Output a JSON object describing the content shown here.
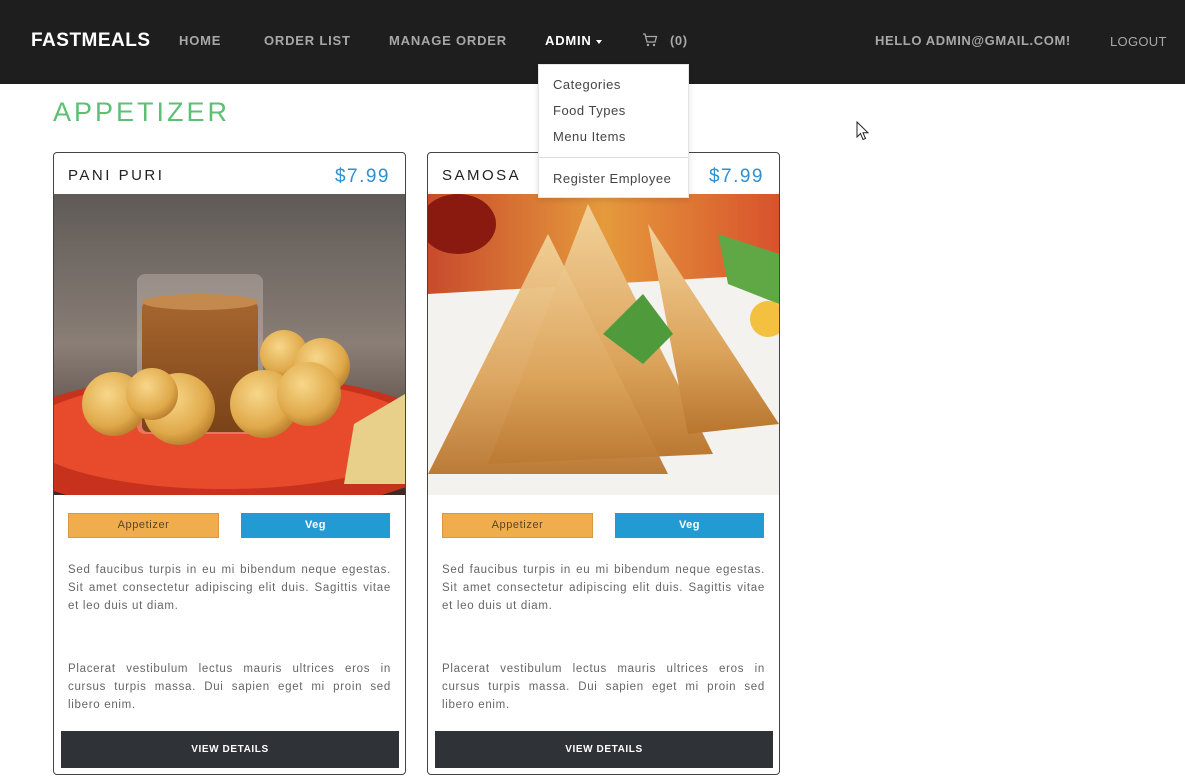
{
  "navbar": {
    "brand": "FASTMEALS",
    "links": {
      "home": "HOME",
      "order_list": "ORDER LIST",
      "manage_order": "MANAGE ORDER",
      "admin": "ADMIN"
    },
    "cart_count": "(0)",
    "greeting": "HELLO ADMIN@GMAIL.COM!",
    "logout": "LOGOUT"
  },
  "admin_menu": {
    "items": [
      "Categories",
      "Food Types",
      "Menu Items",
      "Register Employee"
    ]
  },
  "section": {
    "title": "APPETIZER"
  },
  "cards": [
    {
      "name": "PANI PURI",
      "price": "$7.99",
      "category": "Appetizer",
      "type": "Veg",
      "desc1": "Sed faucibus turpis in eu mi bibendum neque egestas. Sit amet consectetur adipiscing elit duis. Sagittis vitae et leo duis ut diam.",
      "desc2": "Placerat vestibulum lectus mauris ultrices eros in cursus turpis massa. Dui sapien eget mi proin sed libero enim.",
      "button": "VIEW DETAILS",
      "image_icon": "pani-puri-photo"
    },
    {
      "name": "SAMOSA",
      "price": "$7.99",
      "category": "Appetizer",
      "type": "Veg",
      "desc1": "Sed faucibus turpis in eu mi bibendum neque egestas. Sit amet consectetur adipiscing elit duis. Sagittis vitae et leo duis ut diam.",
      "desc2": "Placerat vestibulum lectus mauris ultrices eros in cursus turpis massa. Dui sapien eget mi proin sed libero enim.",
      "button": "VIEW DETAILS",
      "image_icon": "samosa-photo"
    }
  ],
  "colors": {
    "navbar_bg": "#1e1e1e",
    "section_title": "#5cbf74",
    "price": "#2f8fcf",
    "category_badge": "#f0ad4e",
    "type_badge": "#229bd3",
    "button_bg": "#2f3338"
  }
}
